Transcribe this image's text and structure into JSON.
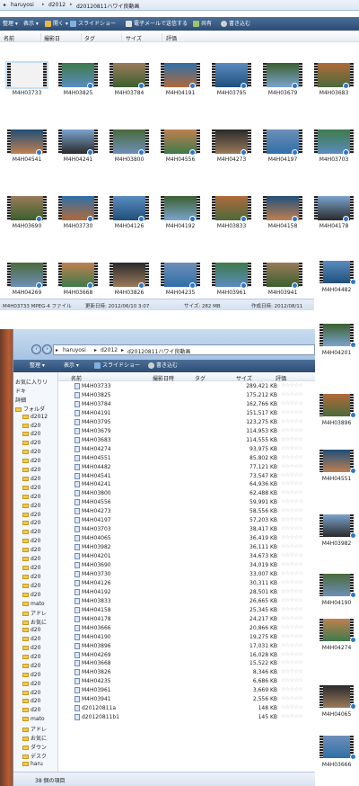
{
  "top": {
    "breadcrumb": [
      "haruyosi",
      "d2012",
      "d20120811ハワイ良動画"
    ],
    "toolbar": [
      "整理 ▾",
      "表示 ▾",
      "開く ▾",
      "スライドショー",
      "電子メールで送信する",
      "共有",
      "書き込む"
    ],
    "columns": [
      "名前",
      "撮影日",
      "タグ",
      "サイズ",
      "評価"
    ],
    "thumbs": [
      "M4H03733",
      "M4H03825",
      "M4H03784",
      "M4H04191",
      "M4H03795",
      "M4H03679",
      "M4H03683",
      "M4H04541",
      "M4H04241",
      "M4H03800",
      "M4H04556",
      "M4H04273",
      "M4H04197",
      "M4H03703",
      "M4H03690",
      "M4H03730",
      "M4H04126",
      "M4H04192",
      "M4H03833",
      "M4H04158",
      "M4H04178",
      "M4H04269",
      "M4H03668",
      "M4H03826",
      "M4H04235",
      "M4H03961",
      "M4H03941"
    ],
    "status": {
      "file": "M4H03733 MPEG-4 ファイル",
      "modified": "更新日時: 2012/06/10 3:07",
      "size": "サイズ: 282 MB",
      "created": "作成日時: 2012/08/11"
    }
  },
  "right_strip": [
    "M4H04482",
    "M4H04201",
    "M4H03896",
    "M4H04551",
    "M4H03982",
    "M4H04190",
    "M4H04274",
    "M4H04065",
    "M4H03666"
  ],
  "bottom": {
    "breadcrumb": [
      "haruyosi",
      "d2012",
      "d20120811ハワイ良動画"
    ],
    "toolbar": [
      "整理 ▾",
      "表示 ▾",
      "スライドショー",
      "書き込む"
    ],
    "columns": [
      "名前",
      "撮影日時",
      "タグ",
      "サイズ",
      "評価"
    ],
    "left_items": [
      "お気に入りリ",
      "ドキ",
      "詳細",
      "フォルダ",
      "d2012",
      "d20",
      "d20",
      "d20",
      "d20",
      "d20",
      "d20",
      "d20",
      "d20",
      "d20",
      "d20",
      "d20",
      "d20",
      "d20",
      "d20",
      "d20",
      "d20",
      "d20",
      "d20",
      "d20",
      "d20",
      "mato",
      "アドレ",
      "お気に",
      "d20",
      "d20",
      "d20",
      "d20",
      "d20",
      "d20",
      "d20",
      "d20",
      "d20",
      "d20",
      "mato",
      "アドレ",
      "お気に",
      "ダウン",
      "デスク",
      "haru"
    ],
    "files": [
      {
        "name": "M4H03733",
        "size": "289,421 KB"
      },
      {
        "name": "M4H03825",
        "size": "175,212 KB"
      },
      {
        "name": "M4H03784",
        "size": "162,766 KB"
      },
      {
        "name": "M4H04191",
        "size": "151,517 KB"
      },
      {
        "name": "M4H03795",
        "size": "123,275 KB"
      },
      {
        "name": "M4H03679",
        "size": "114,953 KB"
      },
      {
        "name": "M4H03683",
        "size": "114,555 KB"
      },
      {
        "name": "M4H04274",
        "size": "93,975 KB"
      },
      {
        "name": "M4H04551",
        "size": "85,802 KB"
      },
      {
        "name": "M4H04482",
        "size": "77,121 KB"
      },
      {
        "name": "M4H04541",
        "size": "73,547 KB"
      },
      {
        "name": "M4H04241",
        "size": "64,936 KB"
      },
      {
        "name": "M4H03800",
        "size": "62,488 KB"
      },
      {
        "name": "M4H04556",
        "size": "59,991 KB"
      },
      {
        "name": "M4H04273",
        "size": "58,556 KB"
      },
      {
        "name": "M4H04197",
        "size": "57,203 KB"
      },
      {
        "name": "M4H03703",
        "size": "38,417 KB"
      },
      {
        "name": "M4H04065",
        "size": "36,419 KB"
      },
      {
        "name": "M4H03982",
        "size": "36,111 KB"
      },
      {
        "name": "M4H04201",
        "size": "34,673 KB"
      },
      {
        "name": "M4H03690",
        "size": "34,019 KB"
      },
      {
        "name": "M4H03730",
        "size": "33,007 KB"
      },
      {
        "name": "M4H04126",
        "size": "30,311 KB"
      },
      {
        "name": "M4H04192",
        "size": "28,501 KB"
      },
      {
        "name": "M4H03833",
        "size": "26,665 KB"
      },
      {
        "name": "M4H04158",
        "size": "25,345 KB"
      },
      {
        "name": "M4H04178",
        "size": "24,217 KB"
      },
      {
        "name": "M4H03666",
        "size": "20,866 KB"
      },
      {
        "name": "M4H04190",
        "size": "19,275 KB"
      },
      {
        "name": "M4H03896",
        "size": "17,031 KB"
      },
      {
        "name": "M4H04269",
        "size": "16,028 KB"
      },
      {
        "name": "M4H03668",
        "size": "15,522 KB"
      },
      {
        "name": "M4H03826",
        "size": "8,346 KB"
      },
      {
        "name": "M4H04235",
        "size": "6,686 KB"
      },
      {
        "name": "M4H03961",
        "size": "3,669 KB"
      },
      {
        "name": "M4H03941",
        "size": "2,556 KB"
      },
      {
        "name": "d20120811a",
        "size": "148 KB"
      },
      {
        "name": "d20120811b1",
        "size": "145 KB"
      }
    ],
    "status": "38 個の項目",
    "stars": "☆☆☆☆☆"
  },
  "colors": {
    "toolbar": "#2c4c74",
    "accent": "#2f77c9",
    "folder": "#f2c94c"
  }
}
